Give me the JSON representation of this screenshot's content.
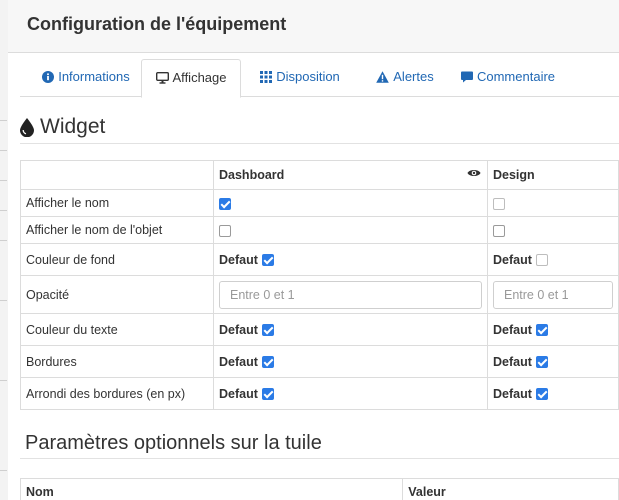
{
  "modal": {
    "title": "Configuration de l'équipement"
  },
  "tabs": [
    {
      "label": "Informations",
      "icon": "info-circle-icon",
      "active": false
    },
    {
      "label": "Affichage",
      "icon": "desktop-icon",
      "active": true
    },
    {
      "label": "Disposition",
      "icon": "grid-icon",
      "active": false
    },
    {
      "label": "Alertes",
      "icon": "warning-icon",
      "active": false
    },
    {
      "label": "Commentaire",
      "icon": "comment-icon",
      "active": false
    }
  ],
  "widget": {
    "title": "Widget",
    "icon": "drop-icon",
    "columns": {
      "dashboard": "Dashboard",
      "design": "Design"
    },
    "rows": {
      "show_name": {
        "label": "Afficher le nom",
        "dashboard_checked": true,
        "design_checked": false
      },
      "show_object_name": {
        "label": "Afficher le nom de l'objet",
        "dashboard_checked": false,
        "design_checked": false
      },
      "background_color": {
        "label": "Couleur de fond",
        "dashboard_value": "Defaut",
        "design_value": "Defaut"
      },
      "opacity": {
        "label": "Opacité",
        "dashboard_placeholder": "Entre 0 et 1",
        "design_placeholder": "Entre 0 et 1"
      },
      "text_color": {
        "label": "Couleur du texte",
        "dashboard_value": "Defaut",
        "design_value": "Defaut"
      },
      "borders": {
        "label": "Bordures",
        "dashboard_value": "Defaut",
        "design_value": "Defaut"
      },
      "border_radius": {
        "label": "Arrondi des bordures (en px)",
        "dashboard_value": "Defaut",
        "design_value": "Defaut"
      }
    }
  },
  "optional": {
    "title": "Paramètres optionnels sur la tuile",
    "columns": {
      "name": "Nom",
      "value": "Valeur"
    }
  },
  "colors": {
    "link": "#2168b4",
    "checkbox": "#2b7be6"
  }
}
